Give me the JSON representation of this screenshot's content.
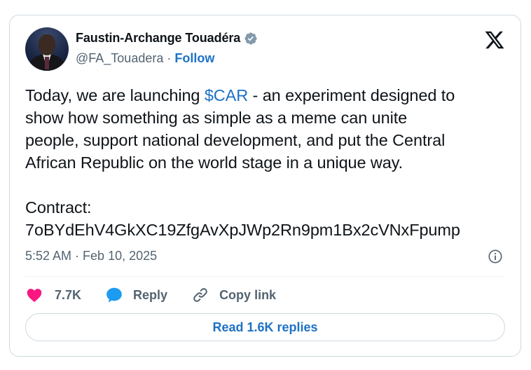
{
  "author": {
    "name": "Faustin-Archange Touadéra",
    "handle": "@FA_Touadera",
    "separator": "·",
    "follow_label": "Follow"
  },
  "tweet": {
    "line1_pre": "Today, we are launching ",
    "cashtag": "$CAR",
    "line1_post": " - an experiment designed to",
    "line2": "show how something as simple as a meme can unite",
    "line3": "people, support national development, and put the Central",
    "line4": "African Republic on the world stage in a unique way.",
    "line5": "Contract:",
    "line6": "7oBYdEhV4GkXC19ZfgAvXpJWp2Rn9pm1Bx2cVNxFpump"
  },
  "meta": {
    "time": "5:52 AM",
    "separator": "·",
    "date": "Feb 10, 2025"
  },
  "actions": {
    "likes": "7.7K",
    "reply_label": "Reply",
    "copy_link_label": "Copy link"
  },
  "read_replies_label": "Read 1.6K replies",
  "colors": {
    "accent": "#1d72c4",
    "like": "#f91880",
    "muted": "#536471",
    "border": "#cfd9de"
  },
  "icons": [
    "verified-badge-icon",
    "x-logo-icon",
    "info-icon",
    "heart-icon",
    "reply-bubble-icon",
    "link-icon"
  ]
}
